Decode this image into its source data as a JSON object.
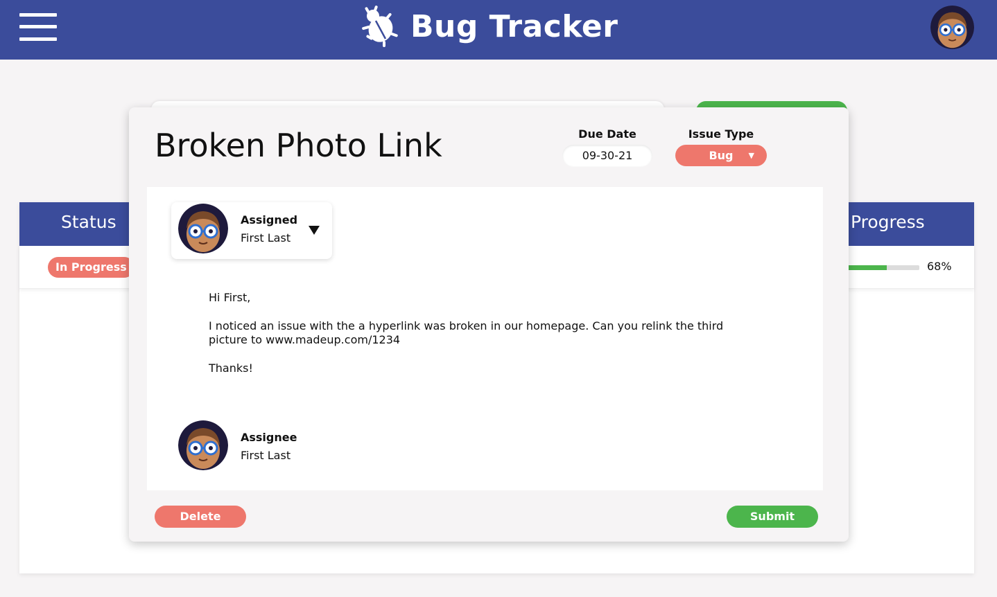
{
  "header": {
    "title": "Bug Tracker",
    "menu_icon": "hamburger-menu-icon",
    "logo_icon": "bug-icon",
    "bar_color": "#3b4c9b"
  },
  "table": {
    "columns": {
      "status": "Status",
      "progress": "Progress"
    },
    "row": {
      "status": "In Progress",
      "progress_text": "68%",
      "progress_value": 0.68
    }
  },
  "issue": {
    "title": "Broken Photo Link",
    "due_date_label": "Due Date",
    "due_date": "09-30-21",
    "issue_type_label": "Issue Type",
    "issue_type": "Bug",
    "assigned": {
      "label": "Assigned",
      "name": "First Last"
    },
    "message": {
      "greeting": "Hi First,",
      "body": "I noticed an issue with the a hyperlink was broken in our homepage. Can you relink the third picture to www.madeup.com/1234",
      "closing": "Thanks!"
    },
    "assignee": {
      "label": "Assignee",
      "name": "First Last"
    },
    "delete_label": "Delete",
    "submit_label": "Submit"
  },
  "colors": {
    "primary": "#3b4c9b",
    "danger": "#ee776c",
    "success": "#4cb54c"
  }
}
